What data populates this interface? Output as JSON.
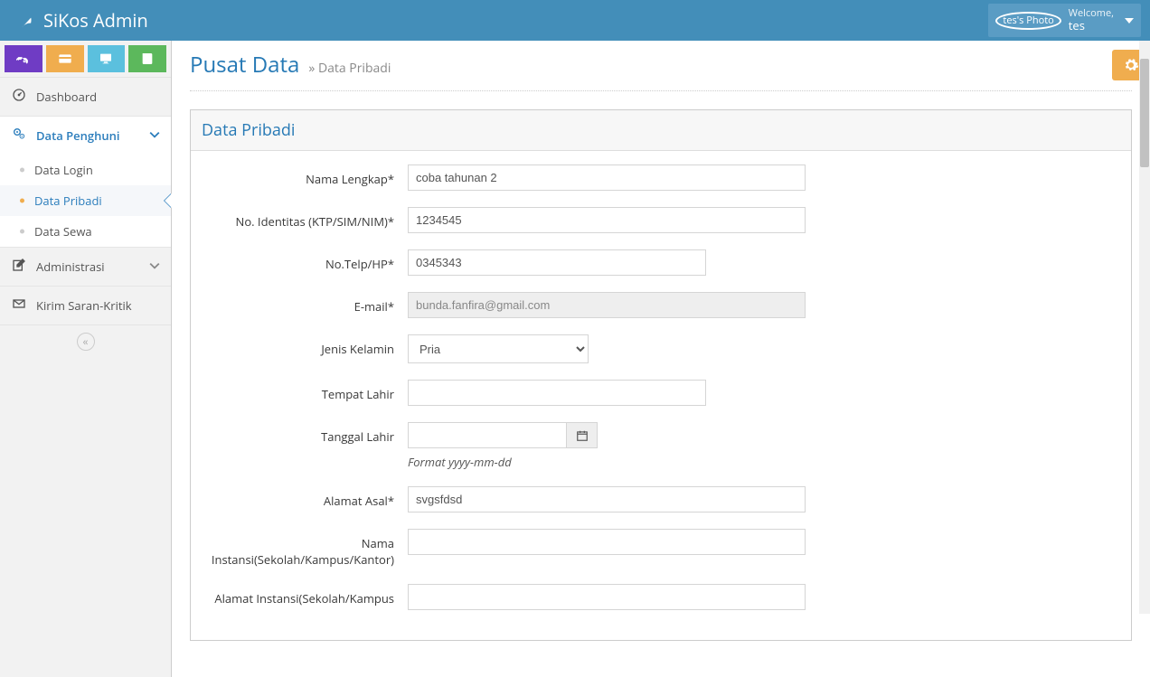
{
  "brand": "SiKos Admin",
  "user": {
    "photo_label": "tes's Photo",
    "welcome": "Welcome,",
    "name": "tes"
  },
  "sidebar": {
    "items": [
      {
        "icon": "dashboard",
        "label": "Dashboard"
      },
      {
        "icon": "cogs",
        "label": "Data Penghuni",
        "active": true,
        "open": true,
        "children": [
          {
            "label": "Data Login"
          },
          {
            "label": "Data Pribadi",
            "active": true
          },
          {
            "label": "Data Sewa"
          }
        ]
      },
      {
        "icon": "edit",
        "label": "Administrasi",
        "open": false
      },
      {
        "icon": "envelope",
        "label": "Kirim Saran-Kritik"
      }
    ]
  },
  "page": {
    "title": "Pusat Data",
    "subtitle": "Data Pribadi"
  },
  "panel": {
    "title": "Data Pribadi"
  },
  "form": {
    "nama_label": "Nama Lengkap*",
    "nama_value": "coba tahunan 2",
    "identitas_label": "No. Identitas (KTP/SIM/NIM)*",
    "identitas_value": "1234545",
    "telp_label": "No.Telp/HP*",
    "telp_value": "0345343",
    "email_label": "E-mail*",
    "email_value": "bunda.fanfira@gmail.com",
    "jk_label": "Jenis Kelamin",
    "jk_value": "Pria",
    "tempat_label": "Tempat Lahir",
    "tempat_value": "",
    "tanggal_label": "Tanggal Lahir",
    "tanggal_value": "",
    "tanggal_help": "Format yyyy-mm-dd",
    "alamat_asal_label": "Alamat Asal*",
    "alamat_asal_value": "svgsfdsd",
    "instansi_label": "Nama Instansi(Sekolah/Kampus/Kantor)",
    "instansi_value": "",
    "alamat_instansi_label": "Alamat Instansi(Sekolah/Kampus",
    "alamat_instansi_value": ""
  }
}
